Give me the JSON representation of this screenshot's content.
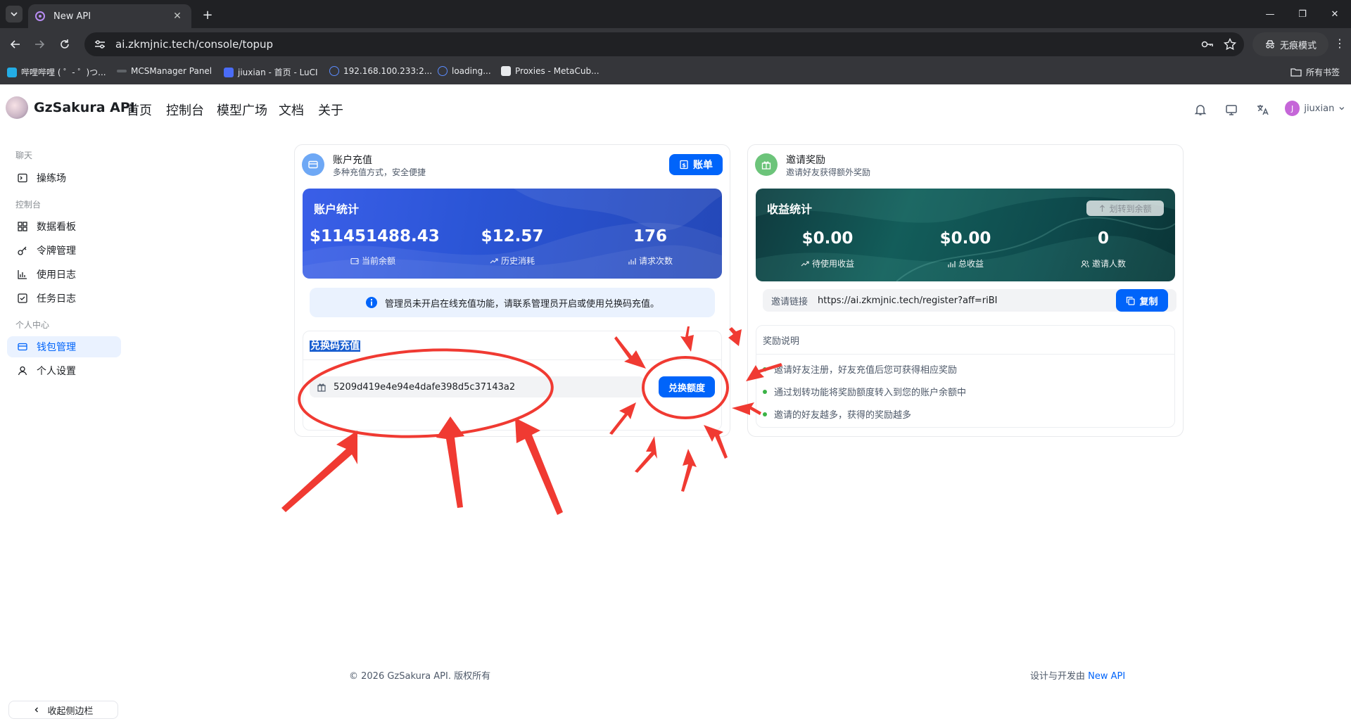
{
  "browser": {
    "tab_title": "New API",
    "url": "ai.zkmjnic.tech/console/topup",
    "incognito_label": "无痕模式",
    "bookmarks": [
      "哔哩哔哩 ( ゜- ゜)つ...",
      "MCSManager Panel",
      "jiuxian - 首页 - LuCI",
      "192.168.100.233:2...",
      "loading...",
      "Proxies - MetaCub..."
    ],
    "all_bookmarks": "所有书签"
  },
  "app": {
    "brand": "GzSakura API",
    "nav": [
      "首页",
      "控制台",
      "模型广场",
      "文档",
      "关于"
    ],
    "username": "jiuxian",
    "avatar_letter": "J"
  },
  "sidebar": {
    "section_chat": "聊天",
    "playground": "操练场",
    "section_console": "控制台",
    "dashboard": "数据看板",
    "tokens": "令牌管理",
    "usage_log": "使用日志",
    "task_log": "任务日志",
    "section_personal": "个人中心",
    "wallet": "钱包管理",
    "settings": "个人设置",
    "collapse": "收起侧边栏"
  },
  "topup": {
    "title": "账户充值",
    "subtitle": "多种充值方式，安全便捷",
    "bill_button": "账单",
    "stats_title": "账户统计",
    "balance": "$11451488.43",
    "balance_label": "当前余额",
    "spent": "$12.57",
    "spent_label": "历史消耗",
    "requests": "176",
    "requests_label": "请求次数",
    "notice": "管理员未开启在线充值功能，请联系管理员开启或使用兑换码充值。",
    "redeem_title": "兑换码充值",
    "redeem_code": "5209d419e4e94e4dafe398d5c37143a2",
    "redeem_button": "兑换额度"
  },
  "invite": {
    "title": "邀请奖励",
    "subtitle": "邀请好友获得额外奖励",
    "stats_title": "收益统计",
    "transfer_button": "划转到余额",
    "pending": "$0.00",
    "pending_label": "待使用收益",
    "total": "$0.00",
    "total_label": "总收益",
    "count": "0",
    "count_label": "邀请人数",
    "link_label": "邀请链接",
    "link": "https://ai.zkmjnic.tech/register?aff=riBI",
    "copy_button": "复制",
    "rules_title": "奖励说明",
    "rules": [
      "邀请好友注册，好友充值后您可获得相应奖励",
      "通过划转功能将奖励额度转入到您的账户余额中",
      "邀请的好友越多，获得的奖励越多"
    ]
  },
  "footer": {
    "copyright": "© 2026 GzSakura API. 版权所有",
    "powered_prefix": "设计与开发由",
    "powered_link": "New API"
  },
  "colors": {
    "accent": "#0064fa",
    "annotation": "#f03a32",
    "topup_gradient": "#2b55d6",
    "invite_gradient": "#0f4f52"
  }
}
